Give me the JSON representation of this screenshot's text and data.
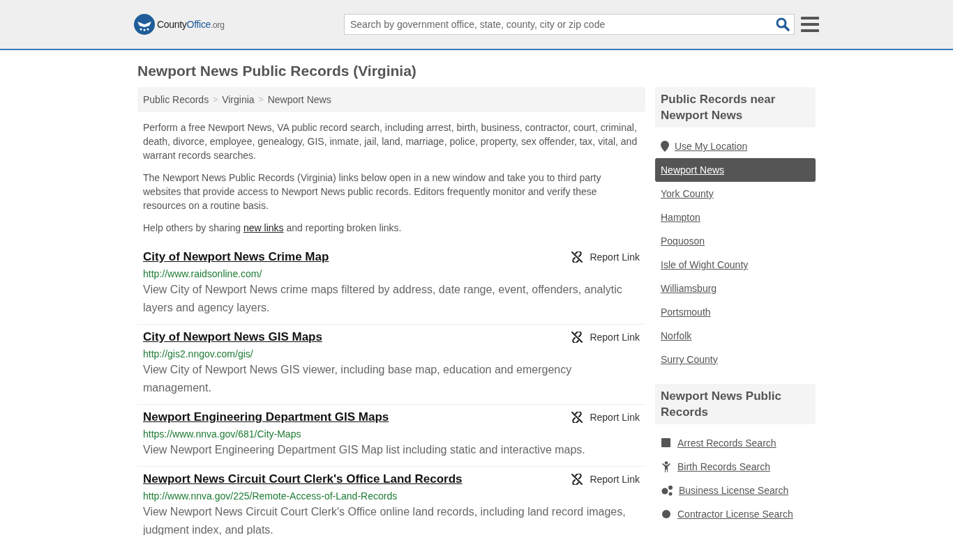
{
  "header": {
    "logo": {
      "brand": "County",
      "brand_accent": "Office",
      "suffix": ".org"
    },
    "search": {
      "placeholder": "Search by government office, state, county, city or zip code"
    }
  },
  "title": "Newport News Public Records (Virginia)",
  "breadcrumbs": [
    {
      "label": "Public Records"
    },
    {
      "label": "Virginia"
    },
    {
      "label": "Newport News"
    }
  ],
  "breadcrumb_separator": ">",
  "intro": [
    "Perform a free Newport News, VA public record search, including arrest, birth, business, contractor, court, criminal, death, divorce, employee, genealogy, GIS, inmate, jail, land, marriage, police, property, sex offender, tax, vital, and warrant records searches.",
    "The Newport News Public Records (Virginia) links below open in a new window and take you to third party websites that provide access to Newport News public records. Editors frequently monitor and verify these resources on a routine basis."
  ],
  "share_note": {
    "before": "Help others by sharing",
    "link": "new links",
    "after": "and reporting broken links."
  },
  "records": [
    {
      "title": "City of Newport News Crime Map",
      "url": "http://www.raidsonline.com/",
      "description": "View City of Newport News crime maps filtered by address, date range, event, offenders, analytic layers and agency layers.",
      "report": "Report Link"
    },
    {
      "title": "City of Newport News GIS Maps",
      "url": "http://gis2.nngov.com/gis/",
      "description": "View City of Newport News GIS viewer, including base map, education and emergency management.",
      "report": "Report Link"
    },
    {
      "title": "Newport Engineering Department GIS Maps",
      "url": "https://www.nnva.gov/681/City-Maps",
      "description": "View Newport Engineering Department GIS Map list including static and interactive maps.",
      "report": "Report Link"
    },
    {
      "title": "Newport News Circuit Court Clerk's Office Land Records",
      "url": "http://www.nnva.gov/225/Remote-Access-of-Land-Records",
      "description": "View Newport News Circuit Court Clerk's Office online land records, including land record images, judgment index, and plats.",
      "report": "Report Link"
    }
  ],
  "sidebar": {
    "nearby": {
      "title": "Public Records near Newport News",
      "location_link": "Use My Location",
      "items": [
        {
          "label": "Newport News",
          "selected": true
        },
        {
          "label": "York County",
          "selected": false
        },
        {
          "label": "Hampton",
          "selected": false
        },
        {
          "label": "Poquoson",
          "selected": false
        },
        {
          "label": "Isle of Wight County",
          "selected": false
        },
        {
          "label": "Williamsburg",
          "selected": false
        },
        {
          "label": "Portsmouth",
          "selected": false
        },
        {
          "label": "Norfolk",
          "selected": false
        },
        {
          "label": "Surry County",
          "selected": false
        }
      ]
    },
    "records": {
      "title": "Newport News Public Records",
      "items": [
        {
          "label": "Arrest Records Search",
          "kind": "arrest"
        },
        {
          "label": "Birth Records Search",
          "kind": "birth"
        },
        {
          "label": "Business License Search",
          "kind": "business"
        },
        {
          "label": "Contractor License Search",
          "kind": "contractor"
        }
      ]
    }
  }
}
